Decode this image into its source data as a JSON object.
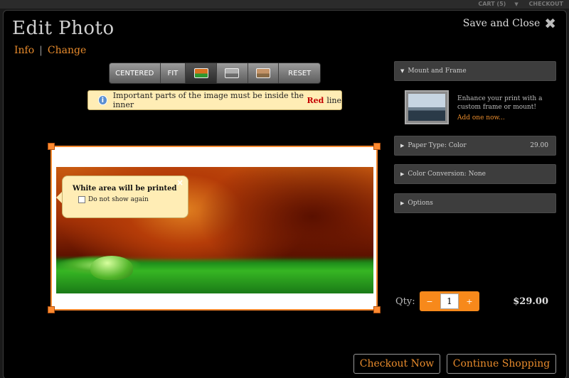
{
  "topbar": {
    "cart": "CART (5)",
    "checkout": "CHECKOUT"
  },
  "header": {
    "title": "Edit Photo",
    "save_close": "Save and Close"
  },
  "subnav": {
    "info": "Info",
    "separator": "|",
    "change": "Change"
  },
  "toolbar": {
    "centered": "CENTERED",
    "fit": "FIT",
    "reset": "RESET",
    "thumbnails": [
      "color",
      "black-and-white",
      "sepia"
    ],
    "active_thumbnail": "color"
  },
  "notice": {
    "prefix": "Important parts of the image must be inside the inner",
    "highlight": "Red",
    "suffix": "line"
  },
  "tooltip": {
    "title": "White area will be printed",
    "checkbox_label": "Do not show again",
    "close": "×"
  },
  "panels": {
    "mount": {
      "label": "Mount and Frame",
      "description": "Enhance your print with a custom frame or mount!",
      "link": "Add one now..."
    },
    "paper": {
      "label": "Paper Type: Color",
      "price": "29.00"
    },
    "color": {
      "label": "Color Conversion: None"
    },
    "options": {
      "label": "Options"
    }
  },
  "quantity": {
    "label": "Qty:",
    "minus": "−",
    "value": "1",
    "plus": "+",
    "total": "$29.00"
  },
  "buttons": {
    "checkout": "Checkout Now",
    "continue": "Continue Shopping"
  },
  "colors": {
    "accent": "#e88b2c",
    "frame": "#ff8a30",
    "notice_bg": "#ffedb5",
    "panel_bg": "#3d3d3d"
  }
}
